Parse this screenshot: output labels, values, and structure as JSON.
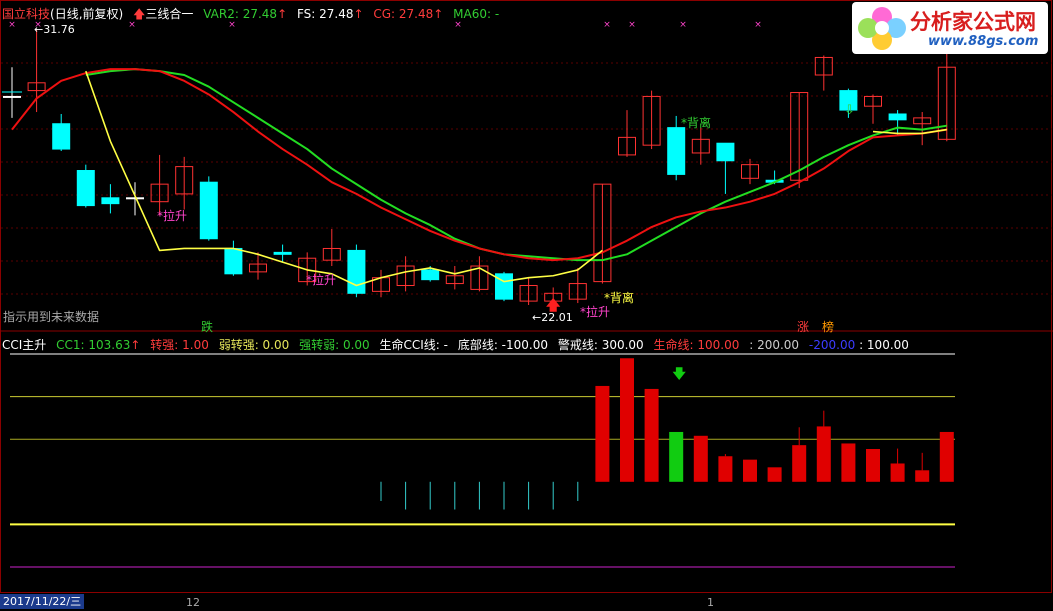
{
  "main_panel": {
    "stock_name": "国立科技",
    "period": "(日线,前复权)",
    "formula_name": "三线合一",
    "indicators": [
      {
        "label": "VAR2: 27.48",
        "color": "#32cd32"
      },
      {
        "label": "FS: 27.48",
        "color": "#ffffff"
      },
      {
        "label": "CG: 27.48",
        "color": "#ff3c3c"
      },
      {
        "label": "MA60: -",
        "color": "#32cd32"
      }
    ],
    "high_label": "31.76",
    "low_label": "22.01",
    "future_data_note": "指示用到未来数据",
    "annotations": {
      "lashen_1": "*拉升",
      "lashen_2": "*拉升",
      "lashen_3": "*拉升",
      "beili_1": "*背离",
      "beili_2": "*背离",
      "die": "跌",
      "zhang": "涨",
      "bang": "榜"
    }
  },
  "sub_panel": {
    "indicator_name": "CCI主升",
    "items": [
      {
        "label": "CC1: 103.63",
        "color": "#32cd32"
      },
      {
        "label": "转强: 1.00",
        "color": "#ff3c3c"
      },
      {
        "label": "弱转强: 0.00",
        "color": "#e6e65a"
      },
      {
        "label": "强转弱: 0.00",
        "color": "#32cd32"
      },
      {
        "label": "生命CCI线: -",
        "color": "#ffffff"
      },
      {
        "label": "底部线: -100.00",
        "color": "#ffffff"
      },
      {
        "label": "警戒线: 300.00",
        "color": "#ffffff"
      },
      {
        "label": "生命线: 100.00",
        "color": "#ff3c3c"
      },
      {
        "label": ": 200.00",
        "color": "#cccccc"
      },
      {
        "label": "-200.00",
        "color": "#3c3cff"
      },
      {
        "label": ": 100.00",
        "color": "#ffffff"
      }
    ]
  },
  "time_axis": {
    "current_date": "2017/11/22/三",
    "month_labels": [
      "12",
      "1"
    ]
  },
  "watermark": {
    "site_name": "分析家公式网",
    "url": "www.88gs.com"
  },
  "colors": {
    "up_candle": "#ff3232",
    "down_candle": "#00ffff",
    "line_green": "#22dd22",
    "line_red": "#ee1111",
    "line_yellow": "#ffff44",
    "magenta": "#ff44cc"
  },
  "candles": [
    {
      "o": 28.3,
      "c": 28.3,
      "h": 29.8,
      "l": 27.2
    },
    {
      "o": 28.6,
      "c": 29.0,
      "h": 31.76,
      "l": 27.5
    },
    {
      "o": 26.9,
      "c": 25.6,
      "h": 27.4,
      "l": 25.5
    },
    {
      "o": 24.5,
      "c": 22.7,
      "h": 24.8,
      "l": 22.6
    },
    {
      "o": 23.1,
      "c": 22.8,
      "h": 23.8,
      "l": 22.3
    },
    {
      "o": 23.1,
      "c": 23.1,
      "h": 23.9,
      "l": 22.2
    },
    {
      "o": 22.9,
      "c": 23.8,
      "h": 25.3,
      "l": 22.2
    },
    {
      "o": 23.3,
      "c": 24.7,
      "h": 25.2,
      "l": 22.5
    },
    {
      "o": 23.9,
      "c": 21.0,
      "h": 24.2,
      "l": 20.9
    },
    {
      "o": 20.5,
      "c": 19.2,
      "h": 20.9,
      "l": 19.1
    },
    {
      "o": 19.3,
      "c": 19.7,
      "h": 20.3,
      "l": 18.9
    },
    {
      "o": 20.3,
      "c": 20.2,
      "h": 20.7,
      "l": 19.8
    },
    {
      "o": 18.8,
      "c": 20.0,
      "h": 20.3,
      "l": 18.6
    },
    {
      "o": 19.9,
      "c": 20.5,
      "h": 21.5,
      "l": 19.6
    },
    {
      "o": 20.4,
      "c": 18.2,
      "h": 20.7,
      "l": 18.0
    },
    {
      "o": 18.3,
      "c": 19.0,
      "h": 19.4,
      "l": 18.0
    },
    {
      "o": 18.6,
      "c": 19.6,
      "h": 20.1,
      "l": 18.3
    },
    {
      "o": 19.4,
      "c": 18.9,
      "h": 19.6,
      "l": 18.8
    },
    {
      "o": 18.7,
      "c": 19.1,
      "h": 19.6,
      "l": 18.4
    },
    {
      "o": 18.4,
      "c": 19.6,
      "h": 20.1,
      "l": 18.3
    },
    {
      "o": 19.2,
      "c": 17.9,
      "h": 19.3,
      "l": 17.8
    },
    {
      "o": 17.8,
      "c": 18.6,
      "h": 19.0,
      "l": 17.6
    },
    {
      "o": 17.8,
      "c": 18.2,
      "h": 18.5,
      "l": 17.7
    },
    {
      "o": 17.9,
      "c": 18.7,
      "h": 19.5,
      "l": 17.7
    },
    {
      "o": 18.8,
      "c": 23.8,
      "h": 23.8,
      "l": 18.7
    },
    {
      "o": 25.3,
      "c": 26.2,
      "h": 27.6,
      "l": 25.2
    },
    {
      "o": 25.8,
      "c": 28.3,
      "h": 28.6,
      "l": 25.6
    },
    {
      "o": 26.7,
      "c": 24.3,
      "h": 27.3,
      "l": 24.0
    },
    {
      "o": 25.4,
      "c": 26.1,
      "h": 26.7,
      "l": 24.8
    },
    {
      "o": 25.9,
      "c": 25.0,
      "h": 25.9,
      "l": 23.3
    },
    {
      "o": 24.1,
      "c": 24.8,
      "h": 25.1,
      "l": 23.8
    },
    {
      "o": 24.0,
      "c": 23.9,
      "h": 24.5,
      "l": 23.8
    },
    {
      "o": 24.0,
      "c": 28.5,
      "h": 28.5,
      "l": 23.6
    },
    {
      "o": 29.4,
      "c": 30.3,
      "h": 30.4,
      "l": 28.6
    },
    {
      "o": 28.6,
      "c": 27.6,
      "h": 28.7,
      "l": 27.2
    },
    {
      "o": 27.8,
      "c": 28.3,
      "h": 28.4,
      "l": 26.9
    },
    {
      "o": 27.4,
      "c": 27.1,
      "h": 27.6,
      "l": 26.3
    },
    {
      "o": 26.9,
      "c": 27.2,
      "h": 27.5,
      "l": 25.8
    },
    {
      "o": 26.1,
      "c": 29.8,
      "h": 31.1,
      "l": 26.0
    }
  ],
  "cci_bars": [
    null,
    null,
    null,
    null,
    null,
    null,
    null,
    null,
    null,
    null,
    null,
    null,
    null,
    null,
    null,
    -45,
    -65,
    -65,
    -65,
    -65,
    -65,
    -65,
    -65,
    -45,
    225,
    290,
    218,
    117,
    108,
    60,
    52,
    34,
    86,
    130,
    90,
    77,
    43,
    27,
    117
  ],
  "cci_bar_colors": [
    "",
    "",
    "",
    "",
    "",
    "",
    "",
    "",
    "",
    "",
    "",
    "",
    "",
    "",
    "",
    "cyan",
    "cyan",
    "cyan",
    "cyan",
    "cyan",
    "cyan",
    "cyan",
    "cyan",
    "cyan",
    "red",
    "red",
    "red",
    "green",
    "red",
    "red",
    "red",
    "red",
    "red",
    "red",
    "red",
    "red",
    "red",
    "red",
    "red"
  ],
  "cci_wick_high": [
    null,
    null,
    null,
    null,
    null,
    null,
    null,
    null,
    null,
    null,
    null,
    null,
    null,
    null,
    null,
    null,
    null,
    null,
    null,
    null,
    null,
    null,
    null,
    null,
    null,
    null,
    null,
    null,
    null,
    65,
    null,
    null,
    128,
    167,
    null,
    null,
    78,
    68,
    null
  ]
}
